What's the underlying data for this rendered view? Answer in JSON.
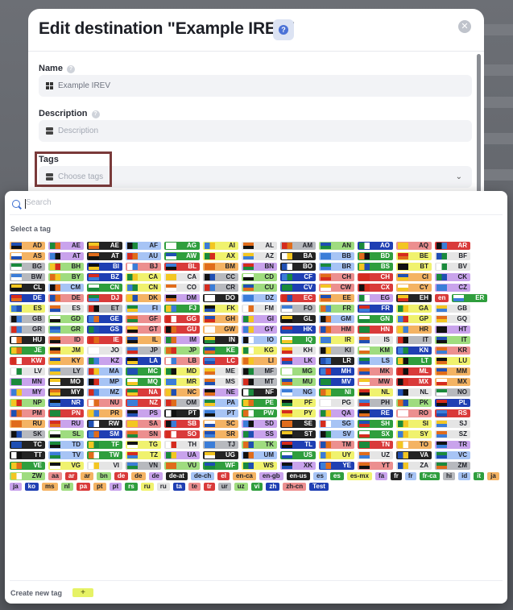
{
  "modal": {
    "title": "Edit destination \"Example IREV\"",
    "help_icon": "question-icon",
    "close_icon": "close-icon"
  },
  "fields": {
    "name": {
      "label": "Name",
      "value": "Example IREV"
    },
    "description": {
      "label": "Description",
      "placeholder": "Description"
    },
    "tags": {
      "label": "Tags",
      "placeholder": "Choose tags"
    }
  },
  "dropdown": {
    "search_placeholder": "Search",
    "select_label": "Select a tag",
    "create_label": "Create new tag",
    "create_button": "+"
  },
  "colors": {
    "accent": "#3d6fd1",
    "highlight_border": "#7a3a3a"
  },
  "tags": [
    "AD",
    "AE",
    "AE",
    "AF",
    "AG",
    "AI",
    "AL",
    "AM",
    "AN",
    "AO",
    "AQ",
    "AR",
    "AS",
    "AT",
    "AT",
    "AU",
    "AW",
    "AX",
    "AZ",
    "BA",
    "BB",
    "BD",
    "BE",
    "BF",
    "BG",
    "BH",
    "BI",
    "BJ",
    "BL",
    "BM",
    "BN",
    "BO",
    "BR",
    "BS",
    "BT",
    "BV",
    "BW",
    "BY",
    "BZ",
    "CA",
    "CA",
    "CC",
    "CD",
    "CF",
    "CH",
    "CH",
    "CI",
    "CK",
    "CL",
    "CM",
    "CN",
    "CN",
    "CO",
    "CR",
    "CU",
    "CV",
    "CW",
    "CX",
    "CY",
    "CZ",
    "DE",
    "DE",
    "DJ",
    "DK",
    "DM",
    "DO",
    "DZ",
    "EC",
    "EE",
    "EG",
    "EH",
    "en",
    "ER",
    "ES",
    "ES",
    "ET",
    "FI",
    "FJ",
    "FK",
    "FM",
    "FO",
    "FR",
    "FR",
    "GA",
    "GB",
    "GB",
    "GD",
    "GE",
    "GF",
    "GG",
    "GH",
    "GI",
    "GL",
    "GM",
    "GN",
    "GP",
    "GQ",
    "GR",
    "GR",
    "GS",
    "GT",
    "GU",
    "GW",
    "GY",
    "HK",
    "HM",
    "HN",
    "HR",
    "HT",
    "HU",
    "ID",
    "IE",
    "IL",
    "IM",
    "IN",
    "IO",
    "IQ",
    "IR",
    "IS",
    "IT",
    "IT",
    "JE",
    "JM",
    "JO",
    "JP",
    "JP",
    "KE",
    "KG",
    "KH",
    "KI",
    "KM",
    "KN",
    "KR",
    "KW",
    "KY",
    "KZ",
    "LA",
    "LB",
    "LC",
    "LI",
    "LK",
    "LR",
    "LS",
    "LT",
    "LU",
    "LV",
    "LY",
    "MA",
    "MC",
    "MD",
    "ME",
    "MF",
    "MG",
    "MH",
    "MK",
    "ML",
    "MM",
    "MN",
    "MO",
    "MP",
    "MQ",
    "MR",
    "MS",
    "MT",
    "MU",
    "MV",
    "MW",
    "MX",
    "MX",
    "MY",
    "MY",
    "MZ",
    "NA",
    "NC",
    "NE",
    "NF",
    "NG",
    "NI",
    "NL",
    "NL",
    "NO",
    "NP",
    "NR",
    "NU",
    "NZ",
    "OM",
    "PA",
    "PE",
    "PF",
    "PG",
    "PH",
    "PK",
    "PL",
    "PM",
    "PN",
    "PR",
    "PS",
    "PT",
    "PT",
    "PW",
    "PY",
    "QA",
    "RE",
    "RO",
    "RS",
    "RU",
    "RU",
    "RW",
    "SA",
    "SB",
    "SC",
    "SD",
    "SE",
    "SG",
    "SH",
    "SI",
    "SJ",
    "SK",
    "SL",
    "SM",
    "SN",
    "SO",
    "SR",
    "SS",
    "ST",
    "SV",
    "SX",
    "SY",
    "SZ",
    "TC",
    "TD",
    "TF",
    "TG",
    "TH",
    "TJ",
    "TK",
    "TL",
    "TM",
    "TN",
    "TO",
    "TR",
    "TT",
    "TV",
    "TW",
    "TZ",
    "UA",
    "UG",
    "UM",
    "US",
    "UY",
    "UZ",
    "VA",
    "VC",
    "VE",
    "VG",
    "VI",
    "VN",
    "VU",
    "WF",
    "WS",
    "XK",
    "YE",
    "YT",
    "ZA",
    "ZM",
    "ZW",
    "aa",
    "ar",
    "ar",
    "bn",
    "de",
    "de",
    "de",
    "de-at",
    "de-ch",
    "el",
    "en-ca",
    "en-gb",
    "en-us",
    "es",
    "es",
    "es-mx",
    "fa",
    "fr",
    "fr",
    "fr-ca",
    "hi",
    "id",
    "it",
    "ja",
    "ja",
    "ko",
    "ms",
    "nl",
    "pa",
    "pt",
    "pt",
    "rs",
    "ru",
    "ru",
    "ta",
    "te",
    "tr",
    "ur",
    "uz",
    "vi",
    "zh",
    "zh-cn",
    "Test"
  ],
  "palette": [
    "#c9a3ec",
    "#9fdc7f",
    "#a7c4f5",
    "#ec8f8f",
    "#f0f26e",
    "#f4b363",
    "#b7b9be",
    "#232323",
    "#1f3fb3",
    "#2f9e3d",
    "#d93a3a",
    "#e5e5e5"
  ],
  "flag_palette": [
    "#d52b1e",
    "#1f4fb3",
    "#1a8a3c",
    "#f3c622",
    "#111111",
    "#ffffff",
    "#3b7dd8",
    "#e06c1b"
  ]
}
